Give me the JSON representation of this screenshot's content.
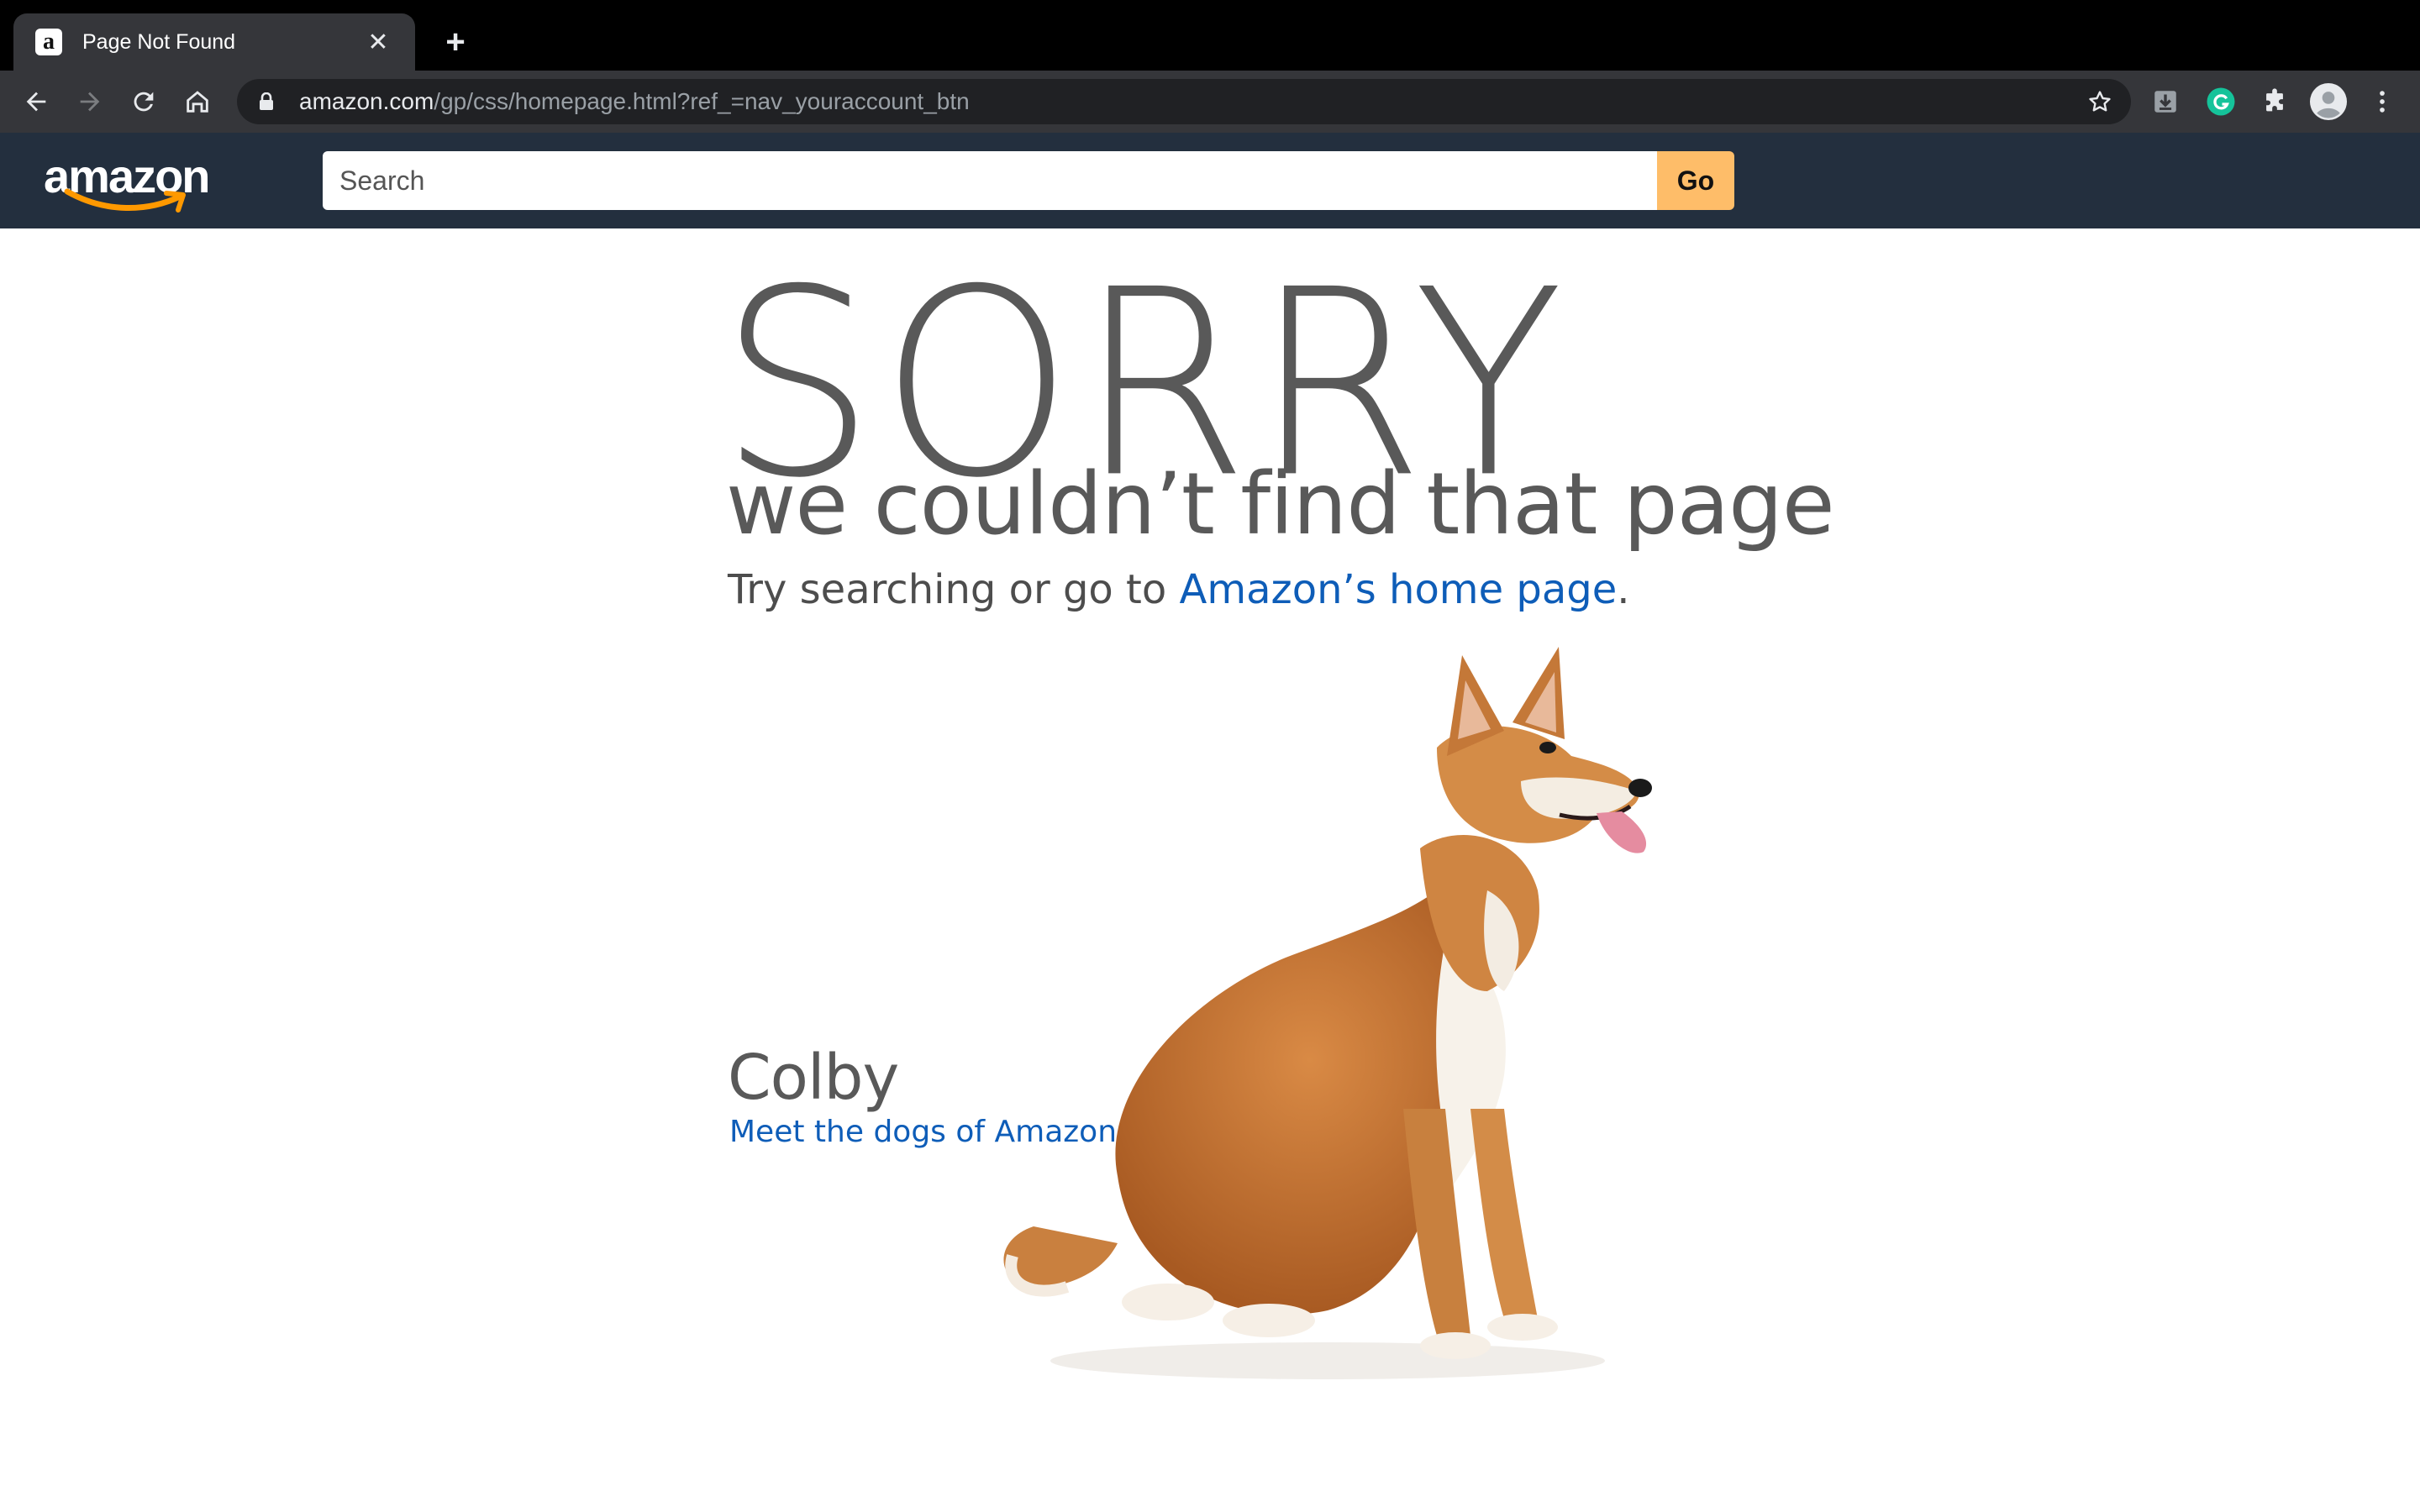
{
  "browser": {
    "tab": {
      "title": "Page Not Found",
      "favicon": "a"
    },
    "new_tab_label": "+",
    "close_label": "✕",
    "address": {
      "host": "amazon.com",
      "path": "/gp/css/homepage.html?ref_=nav_youraccount_btn"
    }
  },
  "amazon_nav": {
    "logo_text": "amazon",
    "search": {
      "placeholder": "Search",
      "value": ""
    },
    "go_label": "Go",
    "colors": {
      "nav_bg": "#232f3e",
      "go_bg": "#febd69",
      "smile": "#ff9900"
    }
  },
  "error_page": {
    "headline": "SORRY",
    "subheadline": "we couldn’t find that page",
    "try_prefix": "Try searching or go to ",
    "home_link": "Amazon’s home page",
    "try_suffix": ".",
    "dog_name": "Colby",
    "dogs_link": "Meet the dogs of Amazon",
    "link_color": "#0e5db8"
  }
}
